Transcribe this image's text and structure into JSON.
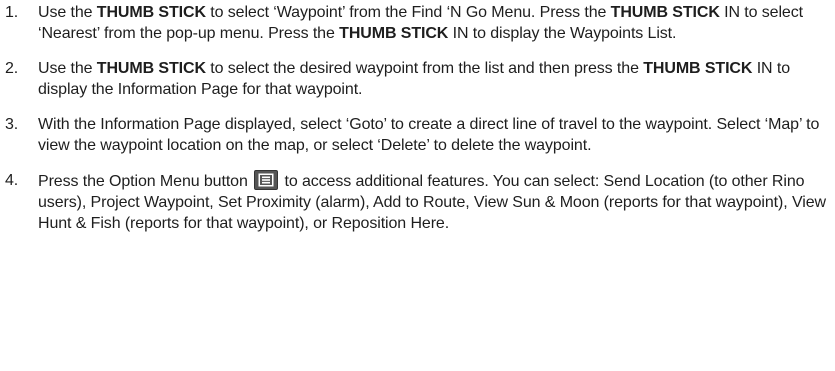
{
  "steps": [
    {
      "number": "1.",
      "parts": [
        "Use the ",
        "THUMB STICK",
        " to select ‘Waypoint’ from the Find ‘N Go Menu. Press the ",
        "THUMB STICK",
        " IN to select ‘Nearest’ from the pop-up menu. Press the ",
        "THUMB STICK",
        " IN to display the Waypoints List."
      ]
    },
    {
      "number": "2.",
      "parts": [
        "Use the ",
        "THUMB STICK",
        " to select the desired waypoint from the list and then press the ",
        "THUMB STICK",
        " IN to display the Information Page for that waypoint."
      ]
    },
    {
      "number": "3.",
      "text": "With the Information Page displayed, select ‘Goto’ to create a direct line of travel to the waypoint. Select ‘Map’ to view the waypoint location on the map, or select ‘Delete’ to delete the waypoint."
    },
    {
      "number": "4.",
      "before_icon": "Press the Option Menu button ",
      "icon": "option-menu-icon",
      "after_icon": " to access additional features. You can select: Send Location (to other Rino users), Project Waypoint, Set Proximity (alarm), Add to Route, View Sun & Moon (reports for that waypoint), View Hunt & Fish (reports for that waypoint), or Reposition Here."
    }
  ]
}
